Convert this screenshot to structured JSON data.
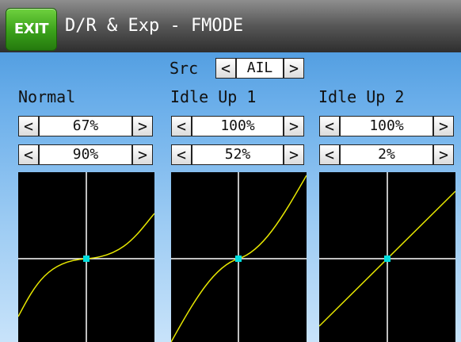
{
  "header": {
    "exit_label": "EXIT",
    "title": "D/R & Exp - FMODE"
  },
  "src": {
    "label": "Src",
    "value": "AIL",
    "prev": "<",
    "next": ">"
  },
  "columns": [
    {
      "name": "Normal",
      "rate": "67%",
      "expo": "90%",
      "curve": "expo-s",
      "prev": "<",
      "next": ">"
    },
    {
      "name": "Idle Up 1",
      "rate": "100%",
      "expo": "52%",
      "curve": "expo-s",
      "prev": "<",
      "next": ">"
    },
    {
      "name": "Idle Up 2",
      "rate": "100%",
      "expo": "2%",
      "curve": "near-linear",
      "prev": "<",
      "next": ">"
    }
  ],
  "colors": {
    "curve": "#e6e600",
    "center_marker": "#00e0e0",
    "axis": "#ffffff",
    "graph_bg": "#000000",
    "exit_bg": "#3aa01a"
  }
}
